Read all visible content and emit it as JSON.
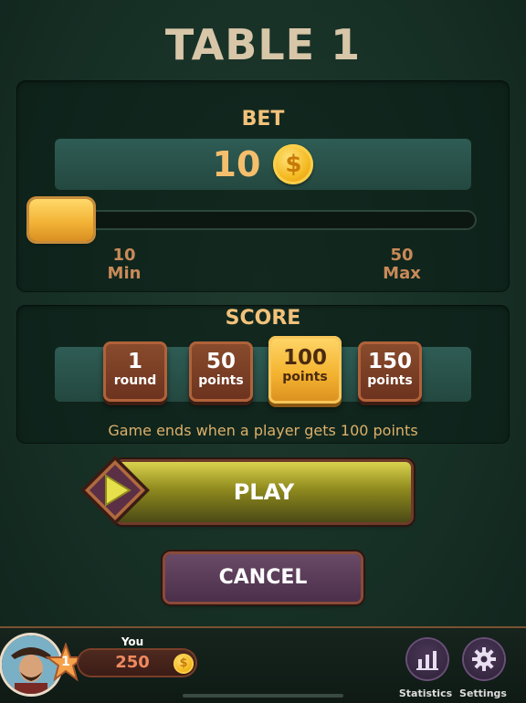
{
  "header": {
    "title": "TABLE 1"
  },
  "bet": {
    "label": "BET",
    "value": "10",
    "coin_symbol": "$",
    "slider": {
      "level": 0,
      "min_value": "10",
      "min_label": "Min",
      "max_value": "50",
      "max_label": "Max"
    }
  },
  "score": {
    "label": "SCORE",
    "options": [
      {
        "num": "1",
        "unit": "round",
        "selected": false
      },
      {
        "num": "50",
        "unit": "points",
        "selected": false
      },
      {
        "num": "100",
        "unit": "points",
        "selected": true
      },
      {
        "num": "150",
        "unit": "points",
        "selected": false
      }
    ],
    "note": "Game ends when a player gets 100 points"
  },
  "actions": {
    "play_label": "PLAY",
    "cancel_label": "CANCEL"
  },
  "player": {
    "name_label": "You",
    "level": "1",
    "balance": "250",
    "coin_symbol": "$"
  },
  "nav": {
    "statistics_label": "Statistics",
    "settings_label": "Settings"
  },
  "colors": {
    "accent_gold": "#f4b431",
    "label_orange": "#f2c27a",
    "play_yellow": "#d9d24e",
    "cancel_purple": "#5a3a58"
  }
}
